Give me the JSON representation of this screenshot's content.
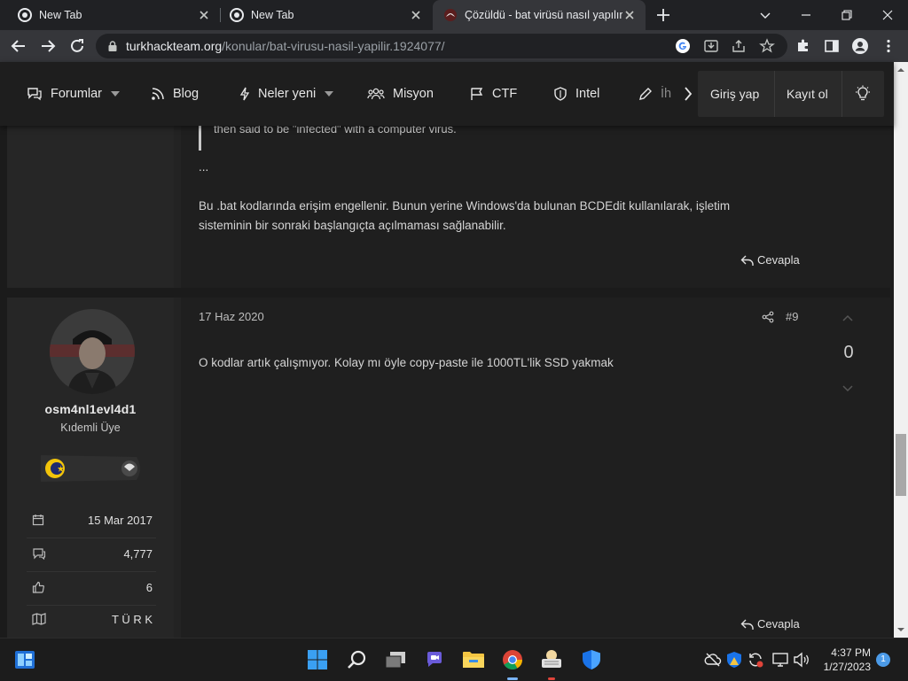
{
  "browser": {
    "tabs": [
      {
        "title": "New Tab"
      },
      {
        "title": "New Tab"
      },
      {
        "title": "Çözüldü - bat virüsü nasıl yapılır |"
      }
    ],
    "url_host": "turkhackteam.org",
    "url_path": "/konular/bat-virusu-nasil-yapilir.1924077/"
  },
  "nav": {
    "items": [
      {
        "label": "Forumlar"
      },
      {
        "label": "Blog"
      },
      {
        "label": "Neler yeni"
      },
      {
        "label": "Misyon"
      },
      {
        "label": "CTF"
      },
      {
        "label": "Intel"
      },
      {
        "label": "İh"
      }
    ],
    "login": "Giriş yap",
    "register": "Kayıt ol"
  },
  "post_prev": {
    "quote_tail": "then said to be \"infected\" with a computer virus.",
    "ellipsis": "...",
    "line1": "Bu .bat kodlarında erişim engellenir. Bunun yerine Windows'da bulunan BCDEdit kullanılarak, işletim",
    "line2": "sisteminin bir sonraki başlangıçta açılmaması sağlanabilir.",
    "reply": "Cevapla"
  },
  "post": {
    "date": "17 Haz 2020",
    "number": "#9",
    "text": "O kodlar artık çalışmıyor. Kolay mı öyle copy-paste ile 1000TL'lik SSD yakmak",
    "votes": "0",
    "reply": "Cevapla",
    "user": {
      "name": "osm4nl1evl4d1",
      "title": "Kıdemli Üye",
      "joined": "15 Mar 2017",
      "messages": "4,777",
      "reactions": "6",
      "location": "T Ü R K"
    }
  },
  "taskbar": {
    "time": "4:37 PM",
    "date": "1/27/2023",
    "notifications": "1"
  }
}
